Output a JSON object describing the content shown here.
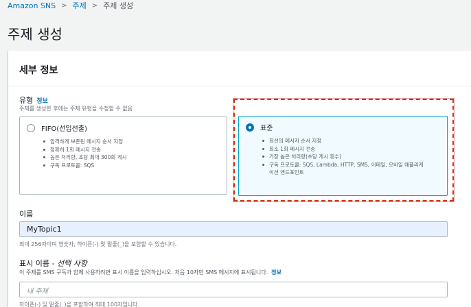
{
  "breadcrumb": {
    "items": [
      "Amazon SNS",
      "주제",
      "주제 생성"
    ],
    "separator": ">"
  },
  "page_title": "주제 생성",
  "details_panel": {
    "title": "세부 정보",
    "type_field": {
      "label": "유형",
      "info": "정보",
      "description": "주제를 생성한 후에는 주제 유형을 수정할 수 없음",
      "options": [
        {
          "title": "FIFO(선입선출)",
          "selected": false,
          "bullets": [
            "엄격하게 보존된 메시지 순서 지정",
            "정확히 1회 메시지 전송",
            "높은 처리량, 초당 최대 300회 게시",
            "구독 프로토콜: SQS"
          ]
        },
        {
          "title": "표준",
          "selected": true,
          "bullets": [
            "최선의 메시지 순서 지정",
            "최소 1회 메시지 전송",
            "가장 높은 처리량(초당 게시 횟수)",
            "구독 프로토콜: SQS, Lambda, HTTP, SMS, 이메일, 모바일 애플리케이션 엔드포인트"
          ]
        }
      ]
    },
    "name_field": {
      "label": "이름",
      "value": "MyTopic1",
      "hint": "최대 256자이며 영숫자, 하이픈(-) 및 밑줄(_)을 포함할 수 있습니다."
    },
    "display_name_field": {
      "label": "표시 이름 - ",
      "label_optional": "선택 사항",
      "description": "이 주제를 SMS 구독과 함께 사용하려면 표시 이름을 입력하십시오. 처음 10자만 SMS 메시지에 표시됩니다.",
      "info": "정보",
      "placeholder": "내 주제",
      "hint": "하이픈(-) 및 밑줄(_)을 포함하여 최대 100자입니다."
    }
  },
  "colors": {
    "link": "#0073bb",
    "selected_border": "#00a1c9",
    "focus_dashed": "#d13212",
    "filled_input": "#e8f0fe"
  }
}
